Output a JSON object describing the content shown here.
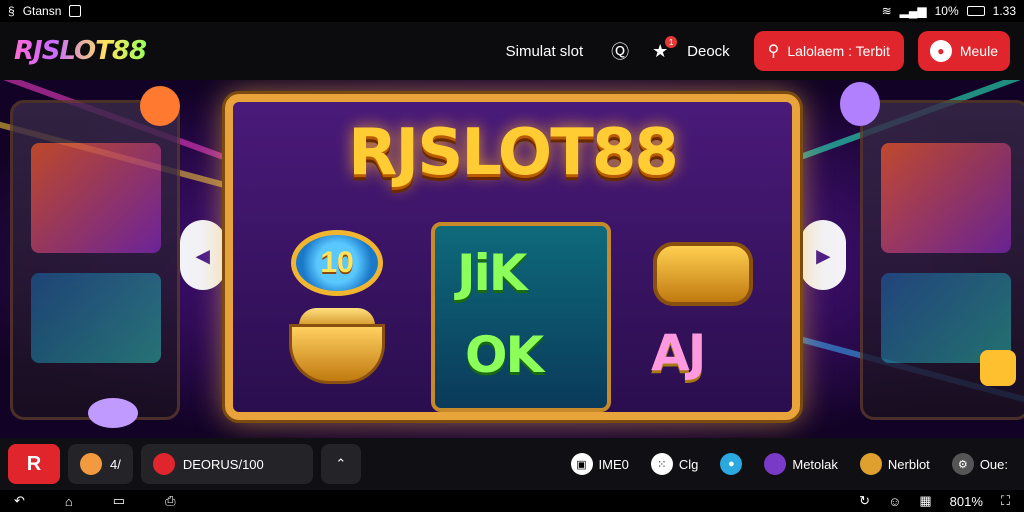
{
  "statusbar": {
    "left_text": "Gtansn",
    "battery_percent": "10%",
    "time": "1.33"
  },
  "header": {
    "logo": "RJSLOT88",
    "nav": {
      "simulat": "Simulat slot",
      "deock": "Deock"
    },
    "search_button_label": "Lalolaem : Terbit",
    "secondary_button_label": "Meule",
    "notification_count": "1"
  },
  "stage": {
    "frame_title": "RJSLOT88",
    "coin_value": "10",
    "center_row1": "JiK",
    "center_row2": "OK",
    "right_row": "AJ"
  },
  "bottombar": {
    "logo_label": "R",
    "pill1_text": "4/",
    "pill2_text": "DEORUS/100",
    "items": [
      {
        "label": "IME0",
        "icon": "gamepad-icon"
      },
      {
        "label": "Clg",
        "icon": "dice-icon"
      },
      {
        "label": "",
        "icon": "chat-icon"
      },
      {
        "label": "Metolak",
        "icon": "avatar-icon"
      },
      {
        "label": "Nerblot",
        "icon": "avatar2-icon"
      },
      {
        "label": "Oue:",
        "icon": "settings-icon"
      }
    ]
  },
  "sysnav": {
    "right_text": "801%"
  },
  "colors": {
    "accent_red": "#e0262c",
    "gold": "#e8a33a",
    "purple": "#7b2cbf"
  }
}
